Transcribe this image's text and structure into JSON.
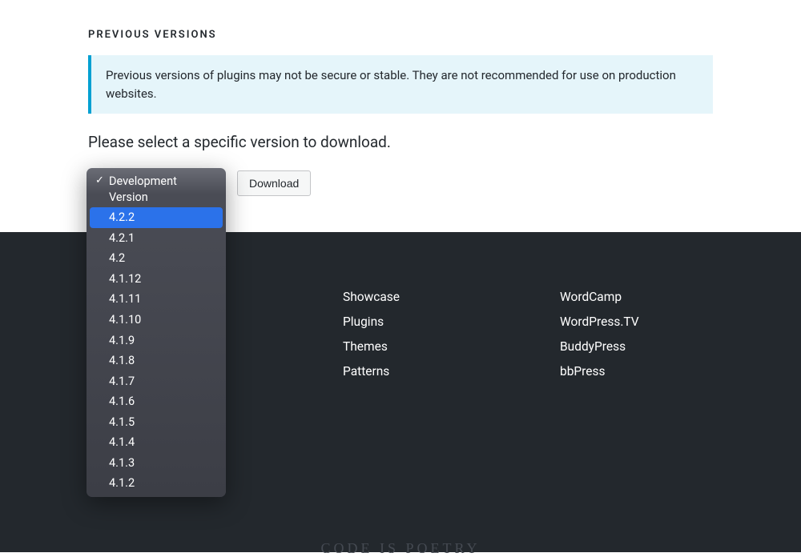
{
  "heading": "PREVIOUS VERSIONS",
  "notice": "Previous versions of plugins may not be secure or stable. They are not recommended for use on production websites.",
  "instruction": "Please select a specific version to download.",
  "download_label": "Download",
  "dropdown": {
    "options": [
      {
        "label": "Development Version",
        "checked": true,
        "highlighted": false
      },
      {
        "label": "4.2.2",
        "checked": false,
        "highlighted": true
      },
      {
        "label": "4.2.1",
        "checked": false,
        "highlighted": false
      },
      {
        "label": "4.2",
        "checked": false,
        "highlighted": false
      },
      {
        "label": "4.1.12",
        "checked": false,
        "highlighted": false
      },
      {
        "label": "4.1.11",
        "checked": false,
        "highlighted": false
      },
      {
        "label": "4.1.10",
        "checked": false,
        "highlighted": false
      },
      {
        "label": "4.1.9",
        "checked": false,
        "highlighted": false
      },
      {
        "label": "4.1.8",
        "checked": false,
        "highlighted": false
      },
      {
        "label": "4.1.7",
        "checked": false,
        "highlighted": false
      },
      {
        "label": "4.1.6",
        "checked": false,
        "highlighted": false
      },
      {
        "label": "4.1.5",
        "checked": false,
        "highlighted": false
      },
      {
        "label": "4.1.4",
        "checked": false,
        "highlighted": false
      },
      {
        "label": "4.1.3",
        "checked": false,
        "highlighted": false
      },
      {
        "label": "4.1.2",
        "checked": false,
        "highlighted": false
      }
    ]
  },
  "footer": {
    "col1": [
      "Showcase",
      "Plugins",
      "Themes",
      "Patterns"
    ],
    "col2": [
      "WordCamp",
      "WordPress.TV",
      "BuddyPress",
      "bbPress"
    ]
  },
  "tagline": "CODE IS POETRY"
}
